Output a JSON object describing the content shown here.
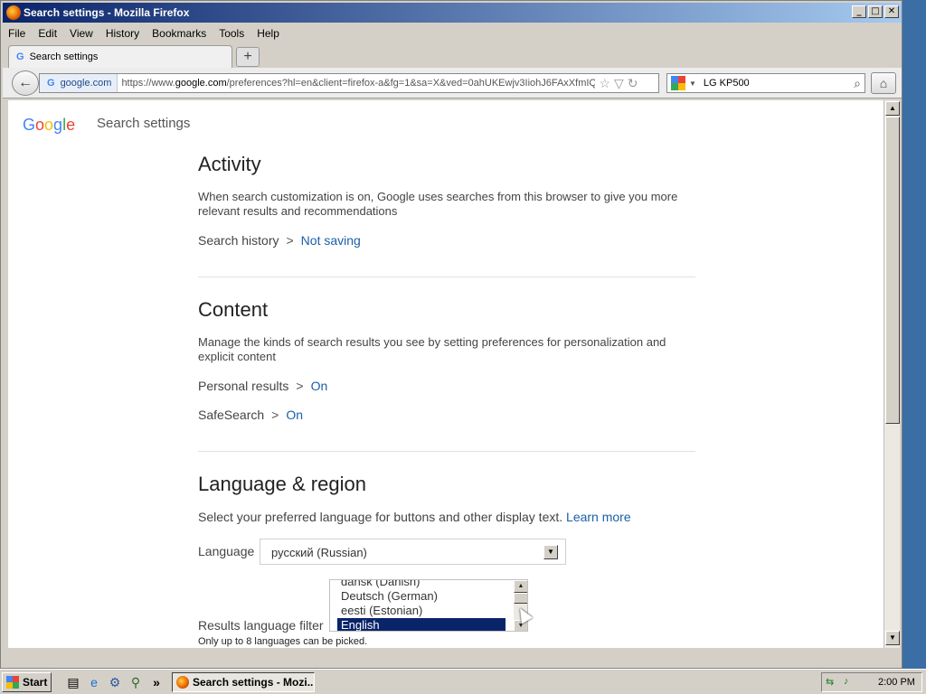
{
  "window": {
    "title": "Search settings - Mozilla Firefox",
    "controls": [
      "_",
      "□",
      "✕"
    ]
  },
  "menu": [
    "File",
    "Edit",
    "View",
    "History",
    "Bookmarks",
    "Tools",
    "Help"
  ],
  "tab": {
    "label": "Search settings",
    "favicon": "G",
    "new_tab": "+"
  },
  "navbar": {
    "back_icon": "←",
    "site_identity": "google.com",
    "site_favicon": "G",
    "url_prefix": "https://www.",
    "url_domain": "google.com",
    "url_rest": "/preferences?hl=en&client=firefox-a&fg=1&sa=X&ved=0ahUKEwjv3IiohJ6FAxXfmIQ",
    "bookmark_icon": "☆",
    "dropdown_icon": "▽",
    "reload_icon": "↻",
    "search_value": "LG KP500",
    "search_icon": "⌕",
    "home_icon": "⌂"
  },
  "page": {
    "logo": "Google",
    "header_title": "Search settings",
    "sections": {
      "activity": {
        "title": "Activity",
        "description": "When search customization is on, Google uses searches from this browser to give you more relevant results and recommendations",
        "history_label": "Search history",
        "history_value": "Not saving"
      },
      "content": {
        "title": "Content",
        "description": "Manage the kinds of search results you see by setting preferences for personalization and explicit content",
        "personal_label": "Personal results",
        "personal_value": "On",
        "safesearch_label": "SafeSearch",
        "safesearch_value": "On"
      },
      "language": {
        "title": "Language & region",
        "description": "Select your preferred language for buttons and other display text.",
        "learn_more": "Learn more",
        "language_label": "Language",
        "language_value": "русский (Russian)",
        "results_filter_label": "Results language filter",
        "filter_options": [
          "dansk (Danish)",
          "Deutsch (German)",
          "eesti (Estonian)",
          "English"
        ],
        "selected_option": "English",
        "note": "Only up to 8 languages can be picked."
      }
    },
    "separator": ">"
  },
  "taskbar": {
    "start_label": "Start",
    "task_label": "Search settings - Mozi...",
    "clock": "2:00 PM",
    "quick_launch_more": "»"
  }
}
